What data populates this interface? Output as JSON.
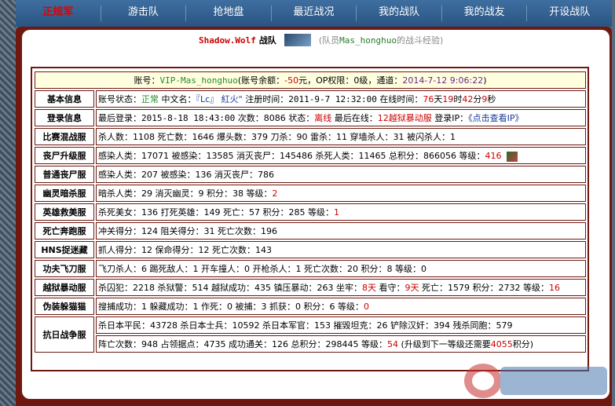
{
  "nav": {
    "items": [
      {
        "label": "正规军",
        "active": true
      },
      {
        "label": "游击队",
        "active": false
      },
      {
        "label": "抢地盘",
        "active": false
      },
      {
        "label": "最近战况",
        "active": false
      },
      {
        "label": "我的战队",
        "active": false
      },
      {
        "label": "我的战友",
        "active": false
      },
      {
        "label": "开设战队",
        "active": false
      }
    ]
  },
  "header": {
    "team_name": "Shadow.Wolf",
    "team_suffix": "战队",
    "note_prefix": "(队员",
    "member_name": "Mas_honghuo",
    "note_suffix": "的战斗经验)"
  },
  "account": {
    "label_account": "账号：",
    "account_id": "VIP-Mas_honghuo",
    "balance_label": "(账号余额：",
    "balance": "-50",
    "balance_unit": "元，",
    "op_label": "OP权限：",
    "op_level": "0级",
    "channel_label": "，通道：",
    "channel_date": "2014-7-12 9:06:22",
    "end": ")"
  },
  "rows": [
    {
      "label": "基本信息"
    },
    {
      "label": "登录信息"
    },
    {
      "label": "比赛混战服"
    },
    {
      "label": "丧尸升级服"
    },
    {
      "label": "普通丧尸服"
    },
    {
      "label": "幽灵暗杀服"
    },
    {
      "label": "英雄救美服"
    },
    {
      "label": "死亡奔跑服"
    },
    {
      "label": "HNS捉迷藏"
    },
    {
      "label": "功夫飞刀服"
    },
    {
      "label": "越狱暴动服"
    },
    {
      "label": "伪装躲猫猫"
    },
    {
      "label": "抗日战争服"
    }
  ],
  "basic": {
    "status_label": "账号状态：",
    "status": "正常",
    "cn_label": " 中文名：",
    "cn_name": "『Lc』 紅火\"",
    "reg_label": "  注册时间：",
    "reg_time": "2011-9-7 12:32:00",
    "online_label": " 在线时间：",
    "d": "76",
    "d_u": "天",
    "h": "19",
    "h_u": "时",
    "mi": "42",
    "mi_u": "分",
    "s": "9",
    "s_u": "秒"
  },
  "login": {
    "last_label": "最后登录：",
    "last": "2015-8-18 18:43:00",
    "count_label": " 次数：",
    "count": "8086",
    "state_label": " 状态：",
    "state": "离线",
    "where_label": " 最后在线：",
    "where": "12越狱暴动服",
    "ip_label": " 登录IP：",
    "ip": "《点击查看IP》"
  },
  "s1": {
    "a": "杀人数：",
    "b": "1108",
    "c": " 死亡数：",
    "d": "1646",
    "e": " 爆头数：",
    "f": "379",
    "g": " 刀杀：",
    "h": "90",
    "i": " 雷杀：",
    "j": "11",
    "k": " 穿墙杀人：",
    "l": "31",
    "m": " 被闪杀人：",
    "n": "1"
  },
  "s2": {
    "a": "感染人类：",
    "b": "17071",
    "c": " 被感染：",
    "d": "13585",
    "e": " 消灭丧尸：",
    "f": "145486",
    "g": " 杀死人类：",
    "h": "11465",
    "i": " 总积分：",
    "j": "866056",
    "k": " 等级：",
    "l": "416"
  },
  "s3": {
    "a": "感染人类：",
    "b": "207",
    "c": " 被感染：",
    "d": "136",
    "e": " 消灭丧尸：",
    "f": "786"
  },
  "s4": {
    "a": "暗杀人类：",
    "b": "29",
    "c": " 消灭幽灵：",
    "d": "9",
    "e": " 积分：",
    "f": "38",
    "g": " 等级：",
    "h": "2"
  },
  "s5": {
    "a": "杀死美女：",
    "b": "136",
    "c": " 打死英雄：",
    "d": "149",
    "e": " 死亡：",
    "f": "57",
    "g": " 积分：",
    "h": "285",
    "i": " 等级：",
    "j": "1"
  },
  "s6": {
    "a": "冲关得分：",
    "b": "124",
    "c": " 阻关得分：",
    "d": "31",
    "e": " 死亡次数：",
    "f": "196"
  },
  "s7": {
    "a": "抓人得分：",
    "b": "12",
    "c": " 保命得分：",
    "d": "12",
    "e": " 死亡次数：",
    "f": "143"
  },
  "s8": {
    "a": "飞刀杀人：",
    "b": "6",
    "c": " 踢死敌人：",
    "d": "1",
    "e": " 开车撞人：",
    "f": "0",
    "g": " 开枪杀人：",
    "h": "1",
    "i": " 死亡次数：",
    "j": "20",
    "k": " 积分：",
    "l": "8",
    "m": " 等级：",
    "n": "0"
  },
  "s9": {
    "a": "杀囚犯：",
    "b": "2218",
    "c": " 杀狱警：",
    "d": "514",
    "e": " 越狱成功：",
    "f": "435",
    "g": " 镇压暴动：",
    "h": "263",
    "i": " 坐牢：",
    "j": "8天",
    "k": " 看守：",
    "l": "9天",
    "m": " 死亡：",
    "n": "1579",
    "o": " 积分：",
    "p": "2732",
    "q": " 等级：",
    "r": "16"
  },
  "s10": {
    "a": "搜捕成功：",
    "b": "1",
    "c": " 躲藏成功：",
    "d": "1",
    "e": " 作死：",
    "f": "0",
    "g": " 被捕：",
    "h": "3",
    "i": " 抓获：",
    "j": "0",
    "k": " 积分：",
    "l": "6",
    "m": " 等级：",
    "n": "0"
  },
  "s11a": {
    "a": "杀日本平民：",
    "b": "43728",
    "c": " 杀日本士兵：",
    "d": "10592",
    "e": " 杀日本军官：",
    "f": "153",
    "g": " 摧毁坦克：",
    "h": "26",
    "i": " 铲除汉奸：",
    "j": "394",
    "k": " 残杀同胞：",
    "l": "579"
  },
  "s11b": {
    "a": "阵亡次数：",
    "b": "948",
    "c": " 占领据点：",
    "d": "4735",
    "e": " 成功通关：",
    "f": "126",
    "g": " 总积分：",
    "h": "298445",
    "i": " 等级：",
    "j": "54",
    "k": " (升级到下一等级还需要",
    "l": "4055",
    "m": "积分)"
  }
}
